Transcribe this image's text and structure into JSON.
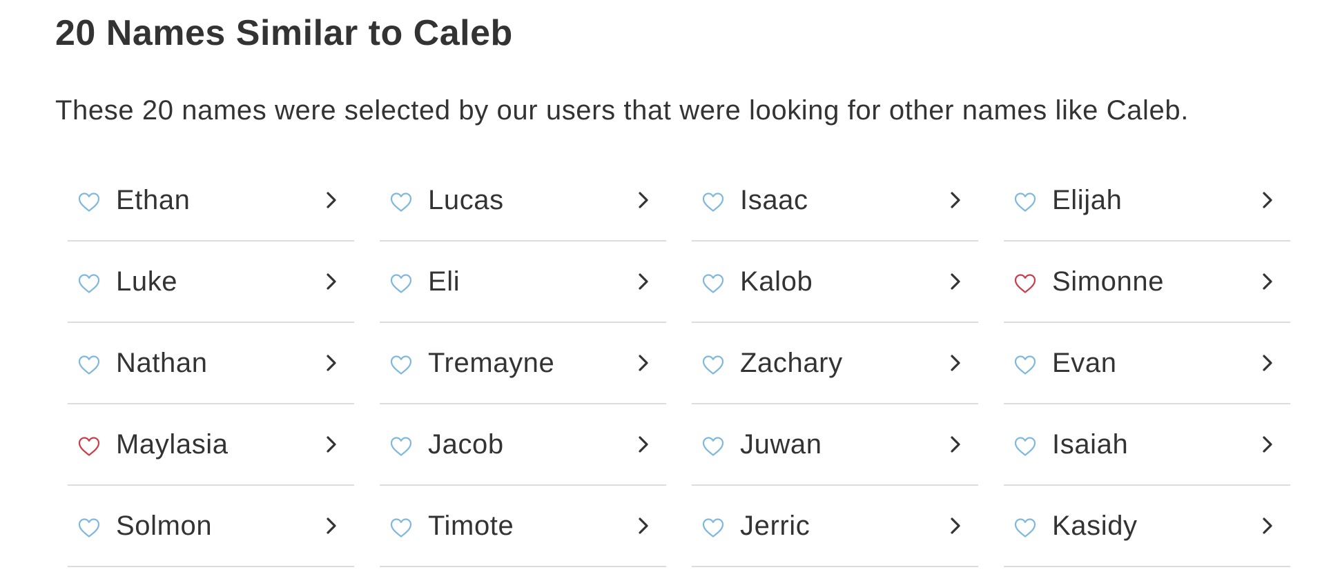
{
  "heading": "20 Names Similar to Caleb",
  "intro": "These 20 names were selected by our users that were looking for other names like Caleb.",
  "colors": {
    "heart_default": "#7fb8dd",
    "heart_favorited": "#cc3b4a",
    "text": "#333333",
    "divider": "#dcdcdc"
  },
  "names": [
    {
      "name": "Ethan",
      "favorited": false
    },
    {
      "name": "Lucas",
      "favorited": false
    },
    {
      "name": "Isaac",
      "favorited": false
    },
    {
      "name": "Elijah",
      "favorited": false
    },
    {
      "name": "Luke",
      "favorited": false
    },
    {
      "name": "Eli",
      "favorited": false
    },
    {
      "name": "Kalob",
      "favorited": false
    },
    {
      "name": "Simonne",
      "favorited": true
    },
    {
      "name": "Nathan",
      "favorited": false
    },
    {
      "name": "Tremayne",
      "favorited": false
    },
    {
      "name": "Zachary",
      "favorited": false
    },
    {
      "name": "Evan",
      "favorited": false
    },
    {
      "name": "Maylasia",
      "favorited": true
    },
    {
      "name": "Jacob",
      "favorited": false
    },
    {
      "name": "Juwan",
      "favorited": false
    },
    {
      "name": "Isaiah",
      "favorited": false
    },
    {
      "name": "Solmon",
      "favorited": false
    },
    {
      "name": "Timote",
      "favorited": false
    },
    {
      "name": "Jerric",
      "favorited": false
    },
    {
      "name": "Kasidy",
      "favorited": false
    }
  ]
}
